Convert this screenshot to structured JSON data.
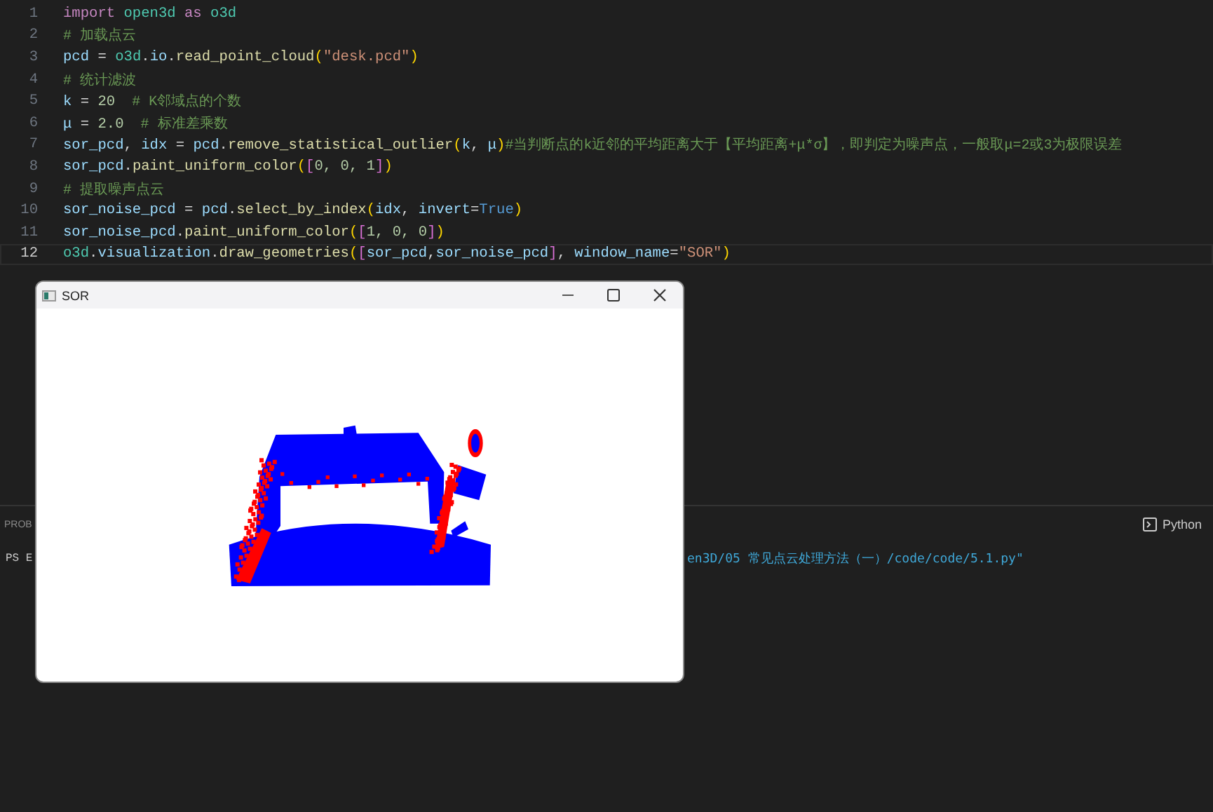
{
  "editor": {
    "lines": [
      {
        "number": "1",
        "current": false,
        "tokens": [
          {
            "kind": "keyword",
            "text": "import"
          },
          {
            "kind": "module",
            "text": "open3d"
          },
          {
            "kind": "keyword",
            "text": "as"
          },
          {
            "kind": "module",
            "text": "o3d"
          }
        ]
      },
      {
        "number": "2",
        "current": false,
        "tokens": [
          {
            "kind": "comment",
            "text": "# 加载点云"
          }
        ]
      },
      {
        "number": "3",
        "current": false,
        "tokens": [
          {
            "kind": "var",
            "text": "pcd"
          },
          {
            "kind": "plain",
            "text": " = "
          },
          {
            "kind": "module",
            "text": "o3d"
          },
          {
            "kind": "plain",
            "text": "."
          },
          {
            "kind": "var",
            "text": "io"
          },
          {
            "kind": "plain",
            "text": "."
          },
          {
            "kind": "func",
            "text": "read_point_cloud"
          },
          {
            "kind": "paren1",
            "text": "("
          },
          {
            "kind": "string",
            "text": "\"desk.pcd\""
          },
          {
            "kind": "paren1",
            "text": ")"
          }
        ]
      },
      {
        "number": "4",
        "current": false,
        "tokens": [
          {
            "kind": "comment",
            "text": "# 统计滤波"
          }
        ]
      },
      {
        "number": "5",
        "current": false,
        "tokens": [
          {
            "kind": "var",
            "text": "k"
          },
          {
            "kind": "plain",
            "text": " = "
          },
          {
            "kind": "number",
            "text": "20"
          },
          {
            "kind": "comment",
            "text": "# K邻域点的个数"
          }
        ]
      },
      {
        "number": "6",
        "current": false,
        "tokens": [
          {
            "kind": "var",
            "text": "μ"
          },
          {
            "kind": "plain",
            "text": " = "
          },
          {
            "kind": "number",
            "text": "2.0"
          },
          {
            "kind": "comment",
            "text": "# 标准差乘数"
          }
        ]
      },
      {
        "number": "7",
        "current": false,
        "tokens": [
          {
            "kind": "var",
            "text": "sor_pcd"
          },
          {
            "kind": "plain",
            "text": ", "
          },
          {
            "kind": "var",
            "text": "idx"
          },
          {
            "kind": "plain",
            "text": " = "
          },
          {
            "kind": "var",
            "text": "pcd"
          },
          {
            "kind": "plain",
            "text": "."
          },
          {
            "kind": "func",
            "text": "remove_statistical_outlier"
          },
          {
            "kind": "paren1",
            "text": "("
          },
          {
            "kind": "var",
            "text": "k"
          },
          {
            "kind": "plain",
            "text": ", "
          },
          {
            "kind": "var",
            "text": "μ"
          },
          {
            "kind": "paren1",
            "text": ")"
          },
          {
            "kind": "comment",
            "text": "#当判断点的k近邻的平均距离大于【平均距离+μ*σ】，即判定为噪声点，一般取μ=2或3为极限误差"
          }
        ]
      },
      {
        "number": "8",
        "current": false,
        "tokens": [
          {
            "kind": "var",
            "text": "sor_pcd"
          },
          {
            "kind": "plain",
            "text": "."
          },
          {
            "kind": "func",
            "text": "paint_uniform_color"
          },
          {
            "kind": "paren1",
            "text": "("
          },
          {
            "kind": "paren2",
            "text": "["
          },
          {
            "kind": "number",
            "text": "0, 0, 1"
          },
          {
            "kind": "paren2",
            "text": "]"
          },
          {
            "kind": "paren1",
            "text": ")"
          }
        ]
      },
      {
        "number": "9",
        "current": false,
        "tokens": [
          {
            "kind": "comment",
            "text": "# 提取噪声点云"
          }
        ]
      },
      {
        "number": "10",
        "current": false,
        "tokens": [
          {
            "kind": "var",
            "text": "sor_noise_pcd"
          },
          {
            "kind": "plain",
            "text": " = "
          },
          {
            "kind": "var",
            "text": "pcd"
          },
          {
            "kind": "plain",
            "text": "."
          },
          {
            "kind": "func",
            "text": "select_by_index"
          },
          {
            "kind": "paren1",
            "text": "("
          },
          {
            "kind": "var",
            "text": "idx"
          },
          {
            "kind": "plain",
            "text": ", "
          },
          {
            "kind": "var",
            "text": "invert"
          },
          {
            "kind": "plain",
            "text": "="
          },
          {
            "kind": "constant",
            "text": "True"
          },
          {
            "kind": "paren1",
            "text": ")"
          }
        ]
      },
      {
        "number": "11",
        "current": false,
        "tokens": [
          {
            "kind": "var",
            "text": "sor_noise_pcd"
          },
          {
            "kind": "plain",
            "text": "."
          },
          {
            "kind": "func",
            "text": "paint_uniform_color"
          },
          {
            "kind": "paren1",
            "text": "("
          },
          {
            "kind": "paren2",
            "text": "["
          },
          {
            "kind": "number",
            "text": "1, 0, 0"
          },
          {
            "kind": "paren2",
            "text": "]"
          },
          {
            "kind": "paren1",
            "text": ")"
          }
        ]
      },
      {
        "number": "12",
        "current": true,
        "tokens": [
          {
            "kind": "module",
            "text": "o3d"
          },
          {
            "kind": "plain",
            "text": "."
          },
          {
            "kind": "var",
            "text": "visualization"
          },
          {
            "kind": "plain",
            "text": "."
          },
          {
            "kind": "func",
            "text": "draw_geometries"
          },
          {
            "kind": "paren1",
            "text": "("
          },
          {
            "kind": "paren2",
            "text": "["
          },
          {
            "kind": "var",
            "text": "sor_pcd"
          },
          {
            "kind": "plain",
            "text": ","
          },
          {
            "kind": "var",
            "text": "sor_noise_pcd"
          },
          {
            "kind": "paren2",
            "text": "]"
          },
          {
            "kind": "plain",
            "text": ", "
          },
          {
            "kind": "var",
            "text": "window_name"
          },
          {
            "kind": "plain",
            "text": "="
          },
          {
            "kind": "string",
            "text": "\"SOR\""
          },
          {
            "kind": "paren1",
            "text": ")"
          }
        ]
      }
    ]
  },
  "window": {
    "title": "SOR"
  },
  "panel": {
    "tab": "PROB",
    "language": "Python",
    "prompt": "PS E",
    "command": "en3D/05 常见点云处理方法（一）/code/code/5.1.py\""
  }
}
